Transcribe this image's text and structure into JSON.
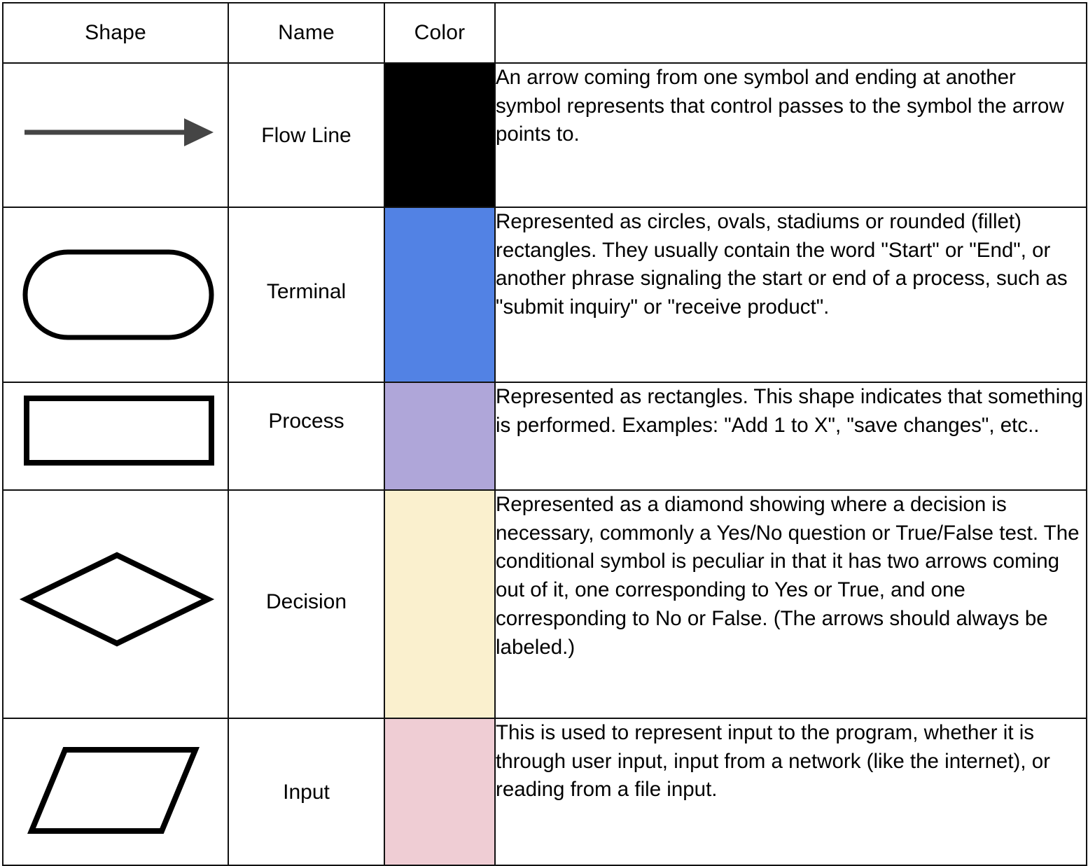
{
  "table": {
    "headers": [
      "Shape",
      "Name",
      "Color",
      ""
    ],
    "rows": [
      {
        "shape_icon": "flow-line-arrow-icon",
        "name": "Flow Line",
        "color": "#000000",
        "color_name": "black",
        "description": "An arrow coming from one symbol and ending at another symbol represents that control passes to the symbol the arrow points to."
      },
      {
        "shape_icon": "stadium-terminal-icon",
        "name": "Terminal",
        "color": "#5282E4",
        "color_name": "blue",
        "description": "Represented as circles, ovals, stadiums or rounded (fillet) rectangles. They usually contain the word \"Start\" or \"End\", or another phrase signaling the start or end of a process, such as \"submit inquiry\" or \"receive product\"."
      },
      {
        "shape_icon": "rectangle-process-icon",
        "name": "Process",
        "color": "#AFA6D9",
        "color_name": "purple",
        "description": "Represented as rectangles. This shape indicates that something is performed. Examples: \"Add 1 to X\", \"save changes\", etc.."
      },
      {
        "shape_icon": "diamond-decision-icon",
        "name": "Decision",
        "color": "#FAF0CE",
        "color_name": "pale yellow",
        "description": "Represented as a diamond showing where a decision is necessary, commonly a Yes/No question or True/False test. The conditional symbol is peculiar in that it has two arrows coming out of it, one corresponding to Yes or True, and one corresponding to No or False. (The arrows should always be labeled.)"
      },
      {
        "shape_icon": "parallelogram-input-icon",
        "name": "Input",
        "color": "#EFCDD4",
        "color_name": "pink",
        "description": "This is used to represent input to the program, whether it is through user input, input from a network (like the internet), or reading from a file input."
      }
    ]
  },
  "style": {
    "stroke": "#111111",
    "arrow_stroke": "#454545",
    "page_background": "#FFFFFF"
  }
}
